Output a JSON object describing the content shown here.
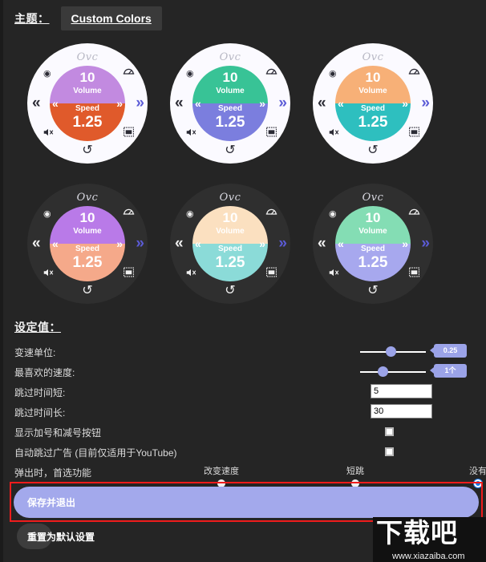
{
  "header": {
    "theme_label": "主题：",
    "theme_button": "Custom Colors"
  },
  "widgets": [
    {
      "name": "theme-light-purple-orange",
      "ring_bg": "#fbfaff",
      "logo": "Ovc",
      "logo_color": "#b8b8c4",
      "icon_color": "#2b2b35",
      "volume_value": "10",
      "volume_label": "Volume",
      "speed_label": "Speed",
      "speed_value": "1.25",
      "top_color": "#c28ae0",
      "bottom_color": "#e05a2b"
    },
    {
      "name": "theme-light-green-blue",
      "ring_bg": "#fbfaff",
      "logo": "Ovc",
      "logo_color": "#b8b8c4",
      "icon_color": "#2b2b35",
      "volume_value": "10",
      "volume_label": "Volume",
      "speed_label": "Speed",
      "speed_value": "1.25",
      "top_color": "#38c396",
      "bottom_color": "#7b7ede"
    },
    {
      "name": "theme-light-orange-teal",
      "ring_bg": "#fbfaff",
      "logo": "Ovc",
      "logo_color": "#b8b8c4",
      "icon_color": "#2b2b35",
      "volume_value": "10",
      "volume_label": "Volume",
      "speed_label": "Speed",
      "speed_value": "1.25",
      "top_color": "#f7b077",
      "bottom_color": "#2ebfbf"
    },
    {
      "name": "theme-dark-purple-peach",
      "ring_bg": "#2f2f2f",
      "logo": "Ovc",
      "logo_color": "#d8d8e0",
      "icon_color": "#f0f0f0",
      "volume_value": "10",
      "volume_label": "Volume",
      "speed_label": "Speed",
      "speed_value": "1.25",
      "top_color": "#b97ae8",
      "bottom_color": "#f5a98a"
    },
    {
      "name": "theme-dark-peach-teal",
      "ring_bg": "#2f2f2f",
      "logo": "Ovc",
      "logo_color": "#d8d8e0",
      "icon_color": "#f0f0f0",
      "volume_value": "10",
      "volume_label": "Volume",
      "speed_label": "Speed",
      "speed_value": "1.25",
      "top_color": "#fbe0c0",
      "bottom_color": "#8bdbd8"
    },
    {
      "name": "theme-dark-mint-periwinkle",
      "ring_bg": "#2f2f2f",
      "logo": "Ovc",
      "logo_color": "#d8d8e0",
      "icon_color": "#f0f0f0",
      "volume_value": "10",
      "volume_label": "Volume",
      "speed_label": "Speed",
      "speed_value": "1.25",
      "top_color": "#84ddb4",
      "bottom_color": "#a7a8ee"
    }
  ],
  "settings": {
    "title": "设定值：",
    "speed_unit": {
      "label": "变速单位:",
      "value": "0.25",
      "thumb_pct": 44
    },
    "favorite_speed": {
      "label": "最喜欢的速度:",
      "value": "1个",
      "thumb_pct": 30
    },
    "skip_short": {
      "label": "跳过时间短:",
      "value": "5"
    },
    "skip_long": {
      "label": "跳过时间长:",
      "value": "30"
    },
    "show_plus_minus": {
      "label": "显示加号和减号按钮",
      "checked": false
    },
    "auto_skip_ads": {
      "label": "自动跳过广告 (目前仅适用于YouTube)",
      "checked": false
    },
    "popup_preference": {
      "label": "弹出时，首选功能",
      "options": [
        {
          "label": "改变速度",
          "selected": false
        },
        {
          "label": "短跳",
          "selected": false
        },
        {
          "label": "没有",
          "selected": true
        }
      ]
    }
  },
  "footer": {
    "save_label": "保存并退出",
    "reset_label": "重置为默认设置"
  },
  "watermark": {
    "main": "下载吧",
    "url": "www.xiazaiba.com"
  },
  "colors": {
    "accent": "#9ba3e8",
    "radio_selected": "#1a7ae8",
    "highlight_border": "#ef1c1c",
    "page_bg": "#252525"
  }
}
